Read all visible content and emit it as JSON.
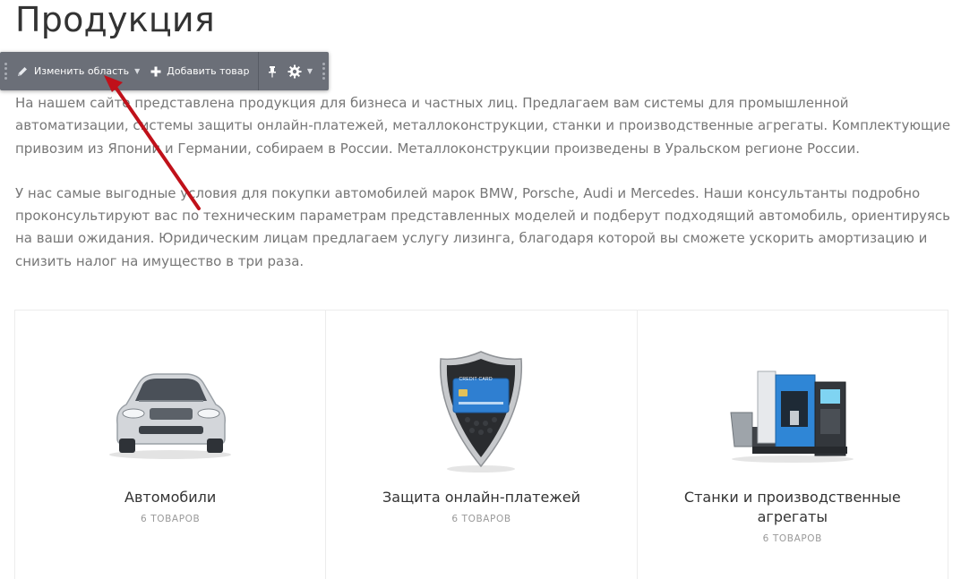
{
  "page": {
    "title": "Продукция"
  },
  "toolbar": {
    "edit_area_label": "Изменить область",
    "add_product_label": "Добавить товар"
  },
  "description": {
    "paragraph1": "На нашем сайте представлена продукция для бизнеса и частных лиц. Предлагаем вам системы для промышленной автоматизации, системы защиты онлайн-платежей, металлоконструкции, станки и производственные агрегаты. Комплектующие привозим из Японии и Германии, собираем в России. Металлоконструкции произведены в Уральском регионе России.",
    "paragraph2": "У нас самые выгодные условия для покупки автомобилей марок BMW, Porsche, Audi и Mercedes. Наши консультанты подробно проконсультируют вас по техническим параметрам представленных моделей и подберут подходящий автомобиль, ориентируясь на ваши ожидания. Юридическим лицам предлагаем услугу лизинга, благодаря которой вы сможете ускорить амортизацию и снизить налог на имущество в три раза."
  },
  "categories": [
    {
      "name": "Автомобили",
      "count": "6 товаров",
      "icon": "car-icon"
    },
    {
      "name": "Защита онлайн-платежей",
      "count": "6 товаров",
      "icon": "shield-credit-card-icon",
      "card_text": "CREDIT CARD"
    },
    {
      "name": "Станки и производственные агрегаты",
      "count": "6 товаров",
      "icon": "machine-tool-icon"
    }
  ],
  "colors": {
    "toolbar_bg": "#6b6f78",
    "annotation_arrow": "#c0111a",
    "text_muted": "#777777"
  }
}
